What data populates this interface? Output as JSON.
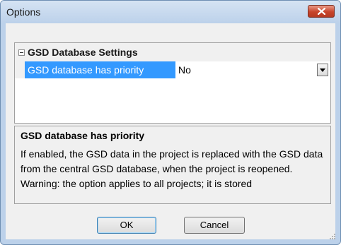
{
  "window": {
    "title": "Options",
    "close_icon": "close-icon"
  },
  "property_grid": {
    "category": {
      "label": "GSD Database Settings",
      "expander_icon": "collapse-minus-icon"
    },
    "properties": [
      {
        "name": "GSD database has priority",
        "value": "No",
        "selected": true
      }
    ]
  },
  "description": {
    "title": "GSD database has priority",
    "text": "If enabled, the GSD data in the project is replaced with the GSD data from the central GSD database, when the project is reopened. Warning: the option applies to all projects; it is stored"
  },
  "buttons": {
    "ok_label": "OK",
    "cancel_label": "Cancel"
  },
  "colors": {
    "selection": "#3399ff",
    "titlebar": "#bcd1ea",
    "close_button": "#c7442b"
  }
}
